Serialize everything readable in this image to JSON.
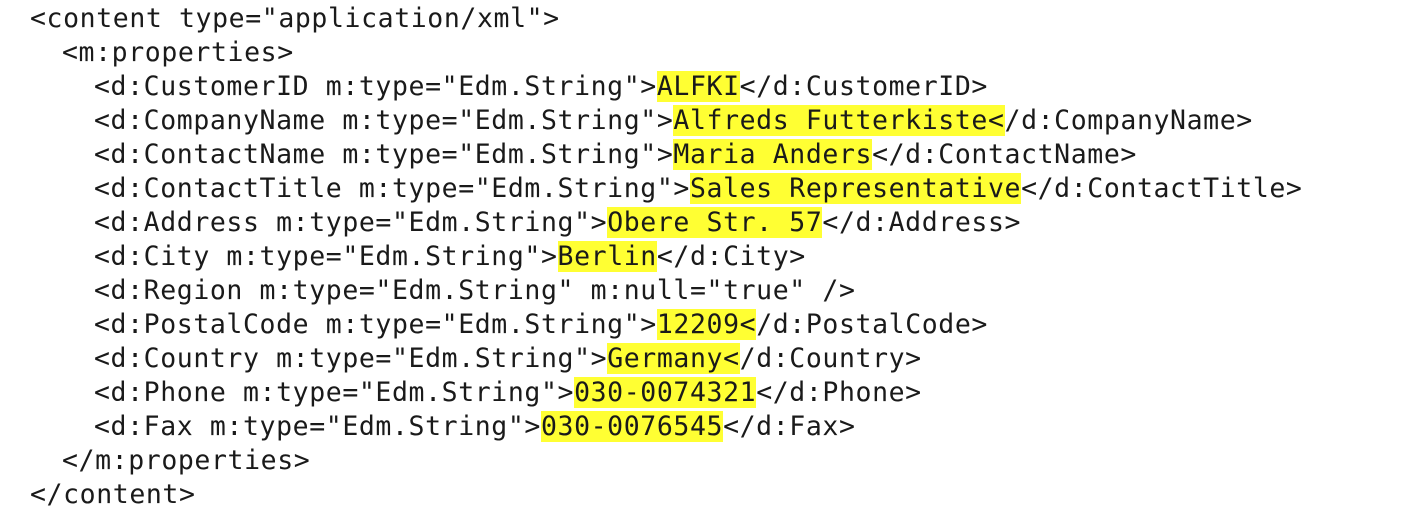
{
  "lines": {
    "content_open": "<content type=\"application/xml\">",
    "properties_open": "<m:properties>",
    "properties_close": "</m:properties>",
    "content_close": "</content>"
  },
  "fields": [
    {
      "open": "<d:CustomerID m:type=\"Edm.String\">",
      "value": "ALFKI",
      "hl_suffix": "",
      "close": "</d:CustomerID>"
    },
    {
      "open": "<d:CompanyName m:type=\"Edm.String\">",
      "value": "Alfreds Futterkiste",
      "hl_suffix": "<",
      "close": "/d:CompanyName>"
    },
    {
      "open": "<d:ContactName m:type=\"Edm.String\">",
      "value": "Maria Anders",
      "hl_suffix": "",
      "close": "</d:ContactName>"
    },
    {
      "open": "<d:ContactTitle m:type=\"Edm.String\">",
      "value": "Sales Representative",
      "hl_suffix": "",
      "close": "</d:ContactTitle>"
    },
    {
      "open": "<d:Address m:type=\"Edm.String\">",
      "value": "Obere Str. 57",
      "hl_suffix": "",
      "close": "</d:Address>"
    },
    {
      "open": "<d:City m:type=\"Edm.String\">",
      "value": "Berlin",
      "hl_suffix": "",
      "close": "</d:City>"
    },
    {
      "open": "<d:Region m:type=\"Edm.String\" m:null=\"true\" />",
      "value": "",
      "hl_suffix": "",
      "close": ""
    },
    {
      "open": "<d:PostalCode m:type=\"Edm.String\">",
      "value": "12209",
      "hl_suffix": "<",
      "close": "/d:PostalCode>"
    },
    {
      "open": "<d:Country m:type=\"Edm.String\">",
      "value": "Germany",
      "hl_suffix": "<",
      "close": "/d:Country>"
    },
    {
      "open": "<d:Phone m:type=\"Edm.String\">",
      "value": "030-0074321",
      "hl_suffix": "",
      "close": "</d:Phone>"
    },
    {
      "open": "<d:Fax m:type=\"Edm.String\">",
      "value": "030-0076545",
      "hl_suffix": "",
      "close": "</d:Fax>"
    }
  ],
  "highlight_color": "#ffff33"
}
